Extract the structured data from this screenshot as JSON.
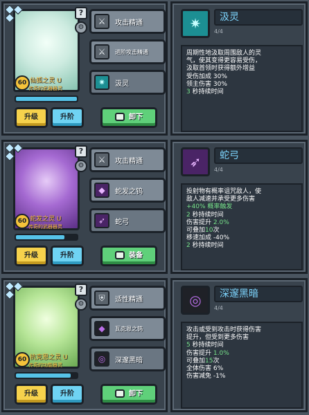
{
  "colors": {
    "accent": "#6fd3f3",
    "gold": "#f5b53b",
    "green": "#77e28a",
    "panel": "#39434d"
  },
  "cards": [
    {
      "portrait_icon": "fox-spirit-icon",
      "level": "60",
      "name": "仙狐之灵 U",
      "subtitle": "传奇的武器器灵",
      "progress": 1.0,
      "btn_up": "升级",
      "btn_adv": "升阶",
      "btn_action": "卸下",
      "slots": [
        {
          "icon": "sword-icon",
          "label": "攻击精通",
          "small": false,
          "tone": "gray"
        },
        {
          "icon": "sword-icon",
          "label": "进阶攻击精通",
          "small": true,
          "tone": "gray"
        },
        {
          "icon": "wind-icon",
          "label": "汲灵",
          "small": false,
          "tone": "teal"
        }
      ],
      "detail": {
        "icon": "wind-icon",
        "title": "汲灵",
        "count": "4/4",
        "lines": [
          {
            "pre": "周期性地汲取周围敌人的灵",
            "g": "",
            "post": ""
          },
          {
            "pre": "气，使其变得更容易受伤，",
            "g": "",
            "post": ""
          },
          {
            "pre": "汲取首领时获得额外增益",
            "g": "",
            "post": ""
          },
          {
            "pre": "受伤加成 30%",
            "g": "",
            "post": ""
          },
          {
            "pre": "领主伤害 30%",
            "g": "",
            "post": ""
          },
          {
            "pre": "",
            "g": "3",
            "post": " 秒持续时间"
          }
        ]
      }
    },
    {
      "portrait_icon": "snake-spirit-icon",
      "level": "60",
      "name": "蛇发之灵 U",
      "subtitle": "传奇的武器器灵",
      "progress": 0.8,
      "btn_up": "升级",
      "btn_adv": "升阶",
      "btn_action": "装备",
      "slots": [
        {
          "icon": "sword-icon",
          "label": "攻击精通",
          "small": false,
          "tone": "gray"
        },
        {
          "icon": "flame-icon",
          "label": "蛇发之钨",
          "small": false,
          "tone": "purp"
        },
        {
          "icon": "bow-icon",
          "label": "蛇弓",
          "small": false,
          "tone": "purp"
        }
      ],
      "detail": {
        "icon": "bow-icon",
        "title": "蛇弓",
        "count": "4/4",
        "lines": [
          {
            "pre": "投射物有概率诅咒敌人，使",
            "g": "",
            "post": ""
          },
          {
            "pre": "敌人减速并承受更多伤害",
            "g": "",
            "post": ""
          },
          {
            "pre": "",
            "g": "+40% 概率触发",
            "post": ""
          },
          {
            "pre": "",
            "g": "2",
            "post": " 秒持续时间"
          },
          {
            "pre": "伤害提升 ",
            "g": "2.0%",
            "post": ""
          },
          {
            "pre": "可叠加",
            "g": "10",
            "post": "次"
          },
          {
            "pre": "移速加成 -40%",
            "g": "",
            "post": ""
          },
          {
            "pre": "",
            "g": "2",
            "post": " 秒持续时间"
          }
        ]
      }
    },
    {
      "portrait_icon": "abyss-spirit-icon",
      "level": "60",
      "name": "抗克恩之灵 U",
      "subtitle": "传奇的功能器灵",
      "progress": 0.9,
      "btn_up": "升级",
      "btn_adv": "升阶",
      "btn_action": "卸下",
      "slots": [
        {
          "icon": "shield-icon",
          "label": "适性精通",
          "small": false,
          "tone": "gray"
        },
        {
          "icon": "flame-icon",
          "label": "瓦克恩之钨",
          "small": true,
          "tone": "dark"
        },
        {
          "icon": "vortex-icon",
          "label": "深邃黑暗",
          "small": false,
          "tone": "dark"
        }
      ],
      "detail": {
        "icon": "vortex-icon",
        "title": "深邃黑暗",
        "count": "4/4",
        "lines": [
          {
            "pre": "攻击或受到攻击时获得伤害",
            "g": "",
            "post": ""
          },
          {
            "pre": "提升，但受到更多伤害",
            "g": "",
            "post": ""
          },
          {
            "pre": "",
            "g": "5",
            "post": " 秒持续时间"
          },
          {
            "pre": "伤害提升 ",
            "g": "1.0%",
            "post": ""
          },
          {
            "pre": "可叠加",
            "g": "15",
            "post": "次"
          },
          {
            "pre": "全体伤害 6%",
            "g": "",
            "post": ""
          },
          {
            "pre": "伤害减免 -1%",
            "g": "",
            "post": ""
          }
        ]
      }
    }
  ]
}
